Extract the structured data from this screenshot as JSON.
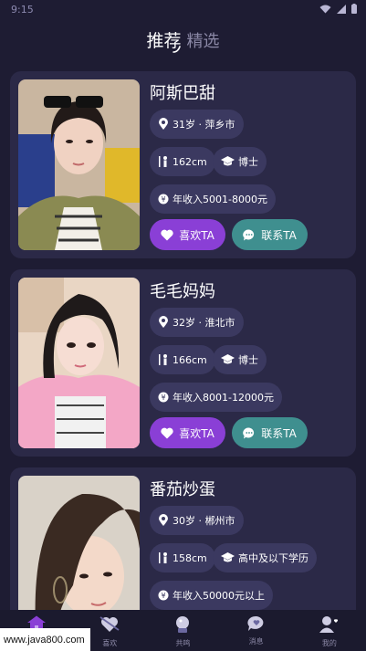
{
  "status_bar": {
    "time": "9:15"
  },
  "tabs": [
    {
      "label": "推荐",
      "active": true
    },
    {
      "label": "精选",
      "active": false
    }
  ],
  "accent_colors": {
    "like": "#8a3fd6",
    "contact": "#3f8f8f",
    "card": "#2b2947",
    "chip": "#3b3960"
  },
  "profiles": [
    {
      "name": "阿斯巴甜",
      "age_location": "31岁 · 萍乡市",
      "height": "162cm",
      "education": "博士",
      "income": "年收入5001-8000元",
      "like_label": "喜欢TA",
      "contact_label": "联系TA"
    },
    {
      "name": "毛毛妈妈",
      "age_location": "32岁 · 淮北市",
      "height": "166cm",
      "education": "博士",
      "income": "年收入8001-12000元",
      "like_label": "喜欢TA",
      "contact_label": "联系TA"
    },
    {
      "name": "番茄炒蛋",
      "age_location": "30岁 · 郴州市",
      "height": "158cm",
      "education": "高中及以下学历",
      "income": "年收入50000元以上"
    }
  ],
  "bottom_nav": [
    {
      "label": "首页",
      "icon": "home-icon"
    },
    {
      "label": "喜欢",
      "icon": "heart-arrow-icon"
    },
    {
      "label": "共鸣",
      "icon": "crystal-ball-icon"
    },
    {
      "label": "消息",
      "icon": "chat-heart-icon"
    },
    {
      "label": "我的",
      "icon": "profile-icon"
    }
  ],
  "watermark": "www.java800.com"
}
